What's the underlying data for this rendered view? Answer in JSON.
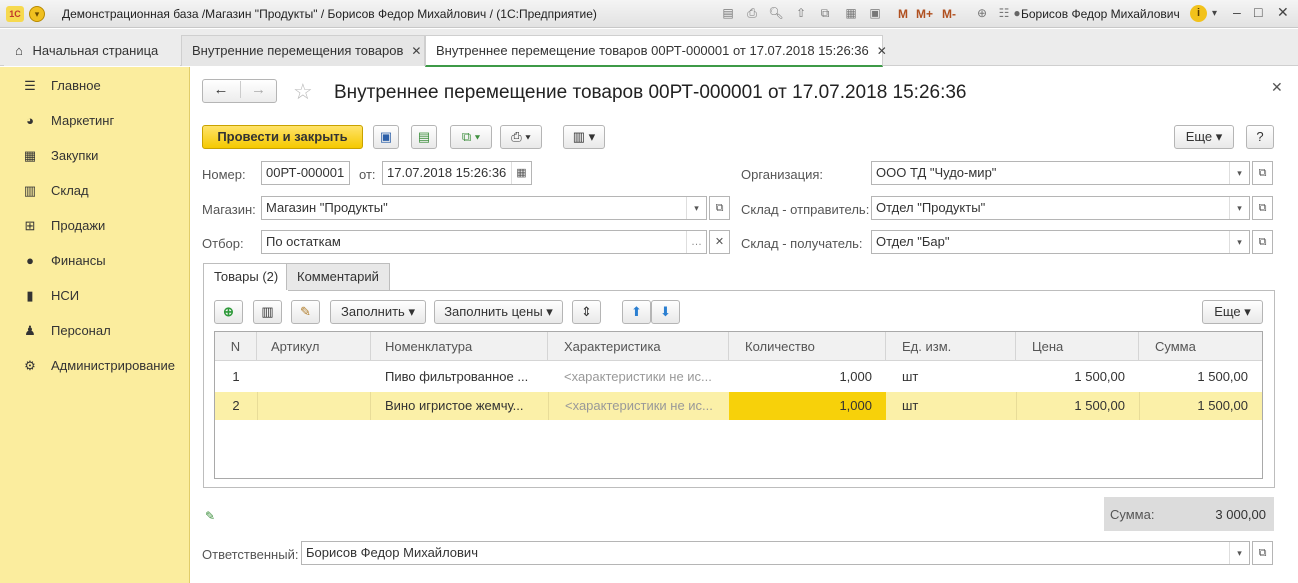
{
  "titlebar": {
    "logo": "1С",
    "title": "Демонстрационная база /Магазин \"Продукты\" / Борисов Федор Михайлович /  (1С:Предприятие)",
    "m": "M",
    "mplus": "M+",
    "mminus": "M-",
    "user": "Борисов Федор Михайлович"
  },
  "tabs": [
    {
      "label": "Начальная страница"
    },
    {
      "label": "Внутренние перемещения товаров"
    },
    {
      "label": "Внутреннее перемещение товаров 00РТ-000001 от 17.07.2018 15:26:36"
    }
  ],
  "sidebar": {
    "items": [
      {
        "label": "Главное",
        "icon": "menu-icon"
      },
      {
        "label": "Маркетинг",
        "icon": "pie-chart-icon"
      },
      {
        "label": "Закупки",
        "icon": "cart-icon"
      },
      {
        "label": "Склад",
        "icon": "warehouse-icon"
      },
      {
        "label": "Продажи",
        "icon": "basket-icon"
      },
      {
        "label": "Финансы",
        "icon": "ruble-icon"
      },
      {
        "label": "НСИ",
        "icon": "books-icon"
      },
      {
        "label": "Персонал",
        "icon": "person-icon"
      },
      {
        "label": "Администрирование",
        "icon": "gear-icon"
      }
    ]
  },
  "doc": {
    "title": "Внутреннее перемещение товаров 00РТ-000001 от 17.07.2018 15:26:36"
  },
  "toolbar": {
    "post_close": "Провести и закрыть",
    "more": "Еще",
    "help": "?"
  },
  "form": {
    "number_label": "Номер:",
    "number": "00РТ-000001",
    "date_label": "от:",
    "date": "17.07.2018 15:26:36",
    "org_label": "Организация:",
    "org": "ООО ТД \"Чудо-мир\"",
    "shop_label": "Магазин:",
    "shop": "Магазин \"Продукты\"",
    "sender_label": "Склад - отправитель:",
    "sender": "Отдел \"Продукты\"",
    "filter_label": "Отбор:",
    "filter": "По остаткам",
    "receiver_label": "Склад - получатель:",
    "receiver": "Отдел \"Бар\""
  },
  "page_tabs": [
    {
      "label": "Товары (2)"
    },
    {
      "label": "Комментарий"
    }
  ],
  "table_toolbar": {
    "fill": "Заполнить",
    "fill_prices": "Заполнить цены",
    "more": "Еще"
  },
  "table": {
    "columns": [
      "N",
      "Артикул",
      "Номенклатура",
      "Характеристика",
      "Количество",
      "Ед. изм.",
      "Цена",
      "Сумма"
    ],
    "rows": [
      {
        "n": "1",
        "article": "",
        "item": "Пиво фильтрованное ...",
        "char": "<характеристики не ис...",
        "qty": "1,000",
        "unit": "шт",
        "price": "1 500,00",
        "sum": "1 500,00"
      },
      {
        "n": "2",
        "article": "",
        "item": "Вино игристое жемчу...",
        "char": "<характеристики не ис...",
        "qty": "1,000",
        "unit": "шт",
        "price": "1 500,00",
        "sum": "1 500,00"
      }
    ]
  },
  "totals": {
    "label": "Сумма:",
    "value": "3 000,00"
  },
  "responsible": {
    "label": "Ответственный:",
    "value": "Борисов Федор Михайлович"
  }
}
